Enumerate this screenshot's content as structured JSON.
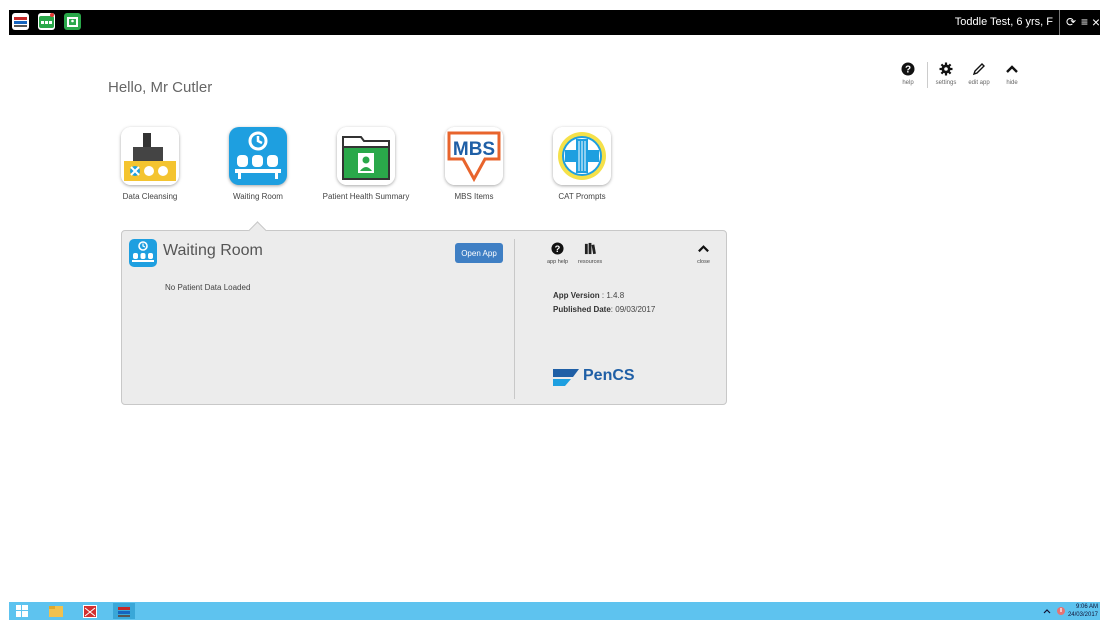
{
  "topbar": {
    "patient_label": "Toddle Test, 6 yrs, F",
    "refresh_glyph": "⟳",
    "menu_glyph": "≡",
    "close_glyph": "×",
    "icons": [
      "database-sync-icon",
      "waiting-room-icon",
      "patient-summary-icon"
    ],
    "colors": {
      "background": "#000000",
      "text": "#ffffff"
    }
  },
  "greeting": "Hello, Mr Cutler",
  "toolbar": {
    "help_label": "help",
    "settings_label": "settings",
    "edit_label": "edit app",
    "hide_label": "hide"
  },
  "apps": [
    {
      "label": "Data Cleansing",
      "icon": "data-cleansing-icon"
    },
    {
      "label": "Waiting Room",
      "icon": "waiting-room-icon"
    },
    {
      "label": "Patient Health Summary",
      "icon": "patient-health-summary-icon"
    },
    {
      "label": "MBS Items",
      "icon": "mbs-items-icon",
      "badge_text": "MBS"
    },
    {
      "label": "CAT Prompts",
      "icon": "cat-prompts-icon"
    }
  ],
  "panel": {
    "title": "Waiting Room",
    "open_button": "Open App",
    "status": "No Patient Data Loaded",
    "app_help_label": "app help",
    "resources_label": "resources",
    "close_label": "close",
    "version_label": "App Version",
    "version_value": " : 1.4.8",
    "published_label": "Published Date",
    "published_value": ": 09/03/2017",
    "vendor": "PenCS"
  },
  "taskbar": {
    "time": "9:06 AM",
    "date": "24/03/2017",
    "colors": {
      "background": "#5ec3ef"
    }
  },
  "colors": {
    "accent": "#1e9fe0",
    "button": "#3f7fc4",
    "panel_bg": "#ececec",
    "vendor_blue": "#1f5fa6"
  }
}
